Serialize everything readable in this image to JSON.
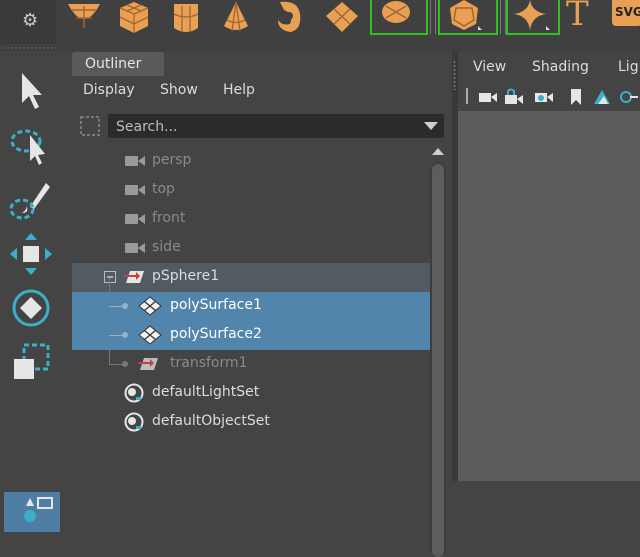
{
  "shelf": {
    "icons": [
      "sphere-icon",
      "cube-icon",
      "cylinder-icon",
      "cone-icon",
      "torus-icon",
      "plane-icon",
      "circle-frame-icon",
      "polyhedron-icon",
      "star-icon",
      "text-icon",
      "svg-icon"
    ],
    "text_icon_glyph": "T",
    "svg_label": "SVG",
    "accent": "#e8a055"
  },
  "outliner": {
    "tab_label": "Outliner",
    "menu": [
      "Display",
      "Show",
      "Help"
    ],
    "search": {
      "placeholder": "Search..."
    },
    "tree": [
      {
        "label": "persp",
        "icon": "camera-icon",
        "dim": true
      },
      {
        "label": "top",
        "icon": "camera-icon",
        "dim": true
      },
      {
        "label": "front",
        "icon": "camera-icon",
        "dim": true
      },
      {
        "label": "side",
        "icon": "camera-icon",
        "dim": true
      },
      {
        "label": "pSphere1",
        "icon": "transform-icon",
        "expanded": true
      },
      {
        "label": "polySurface1",
        "icon": "mesh-icon",
        "selected": true
      },
      {
        "label": "polySurface2",
        "icon": "mesh-icon",
        "selected": true
      },
      {
        "label": "transform1",
        "icon": "transform-icon",
        "dim": true
      },
      {
        "label": "defaultLightSet",
        "icon": "set-icon"
      },
      {
        "label": "defaultObjectSet",
        "icon": "set-icon"
      }
    ]
  },
  "viewport": {
    "menu": [
      "View",
      "Shading",
      "Lig"
    ]
  },
  "colors": {
    "selection": "#5285ab",
    "shelf_highlight": "#2ec11f",
    "viewport_bg": "#5c5c5c"
  }
}
